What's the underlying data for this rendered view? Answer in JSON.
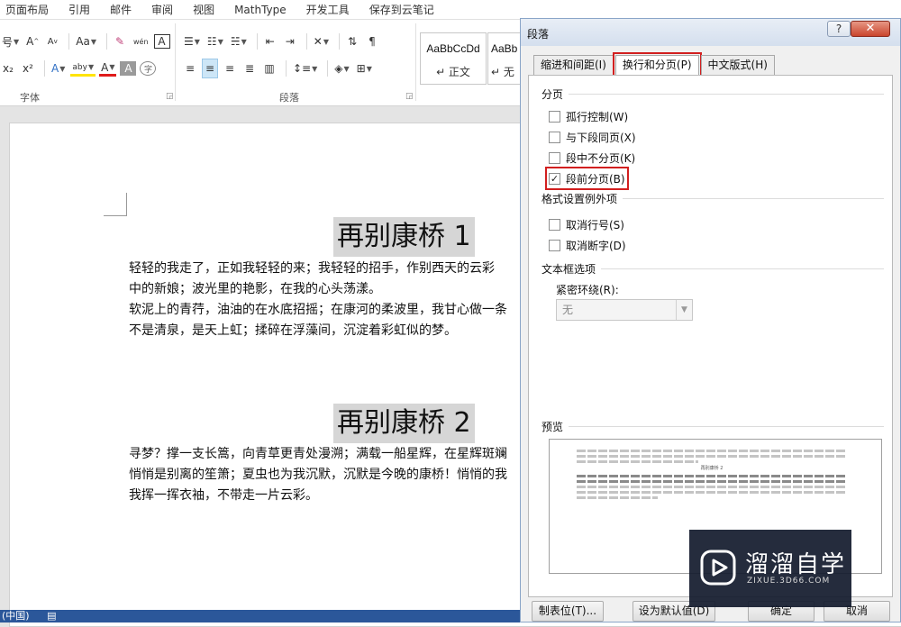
{
  "menubar": {
    "tabs": [
      "页面布局",
      "引用",
      "邮件",
      "审阅",
      "视图",
      "MathType",
      "开发工具",
      "保存到云笔记"
    ]
  },
  "ribbon": {
    "font_group_label": "字体",
    "paragraph_group_label": "段落",
    "font_row1": [
      "号",
      "A",
      "A",
      "Aa",
      "wén",
      "A"
    ],
    "font_row2": [
      "x₂",
      "x²",
      "A",
      "aby",
      "A",
      "A",
      "字"
    ],
    "styles": [
      {
        "sample": "AaBbCcDd",
        "name": "↵ 正文"
      },
      {
        "sample": "AaBb",
        "name": "↵ 无"
      }
    ]
  },
  "document": {
    "heading1": "再别康桥 1",
    "para1": [
      "轻轻的我走了，正如我轻轻的来；我轻轻的招手，作别西天的云彩",
      "中的新娘；波光里的艳影，在我的心头荡漾。",
      "软泥上的青荇，油油的在水底招摇；在康河的柔波里，我甘心做一条",
      "不是清泉，是天上虹；揉碎在浮藻间，沉淀着彩虹似的梦。"
    ],
    "heading2": "再别康桥 2",
    "para2": [
      "寻梦？撑一支长篙，向青草更青处漫溯；满载一船星辉，在星辉斑斓",
      "悄悄是别离的笙箫；夏虫也为我沉默，沉默是今晚的康桥！悄悄的我",
      "我挥一挥衣袖，不带走一片云彩。"
    ]
  },
  "statusbar": {
    "lang": "(中国)"
  },
  "dialog": {
    "title": "段落",
    "help": "?",
    "close": "✕",
    "tabs": [
      "缩进和间距(I)",
      "换行和分页(P)",
      "中文版式(H)"
    ],
    "sections": {
      "pagination": "分页",
      "exceptions": "格式设置例外项",
      "textbox": "文本框选项",
      "preview": "预览"
    },
    "checkboxes": {
      "widow": {
        "label": "孤行控制(W)",
        "checked": false
      },
      "keep_next": {
        "label": "与下段同页(X)",
        "checked": false
      },
      "keep_lines": {
        "label": "段中不分页(K)",
        "checked": false
      },
      "page_break": {
        "label": "段前分页(B)",
        "checked": true
      },
      "suppress_line_numbers": {
        "label": "取消行号(S)",
        "checked": false
      },
      "no_hyphenation": {
        "label": "取消断字(D)",
        "checked": false
      }
    },
    "tight_wrap_label": "紧密环绕(R):",
    "tight_wrap_value": "无",
    "preview_title": "再别康桥 2",
    "buttons": {
      "tabs": "制表位(T)...",
      "default": "设为默认值(D)",
      "ok": "确定",
      "cancel": "取消"
    }
  },
  "watermark": {
    "name": "溜溜自学",
    "url": "ZIXUE.3D66.COM"
  },
  "colors": {
    "highlight": "#d21f1f",
    "statusbar": "#2b579a",
    "heading_bg": "#d6d6d6"
  }
}
